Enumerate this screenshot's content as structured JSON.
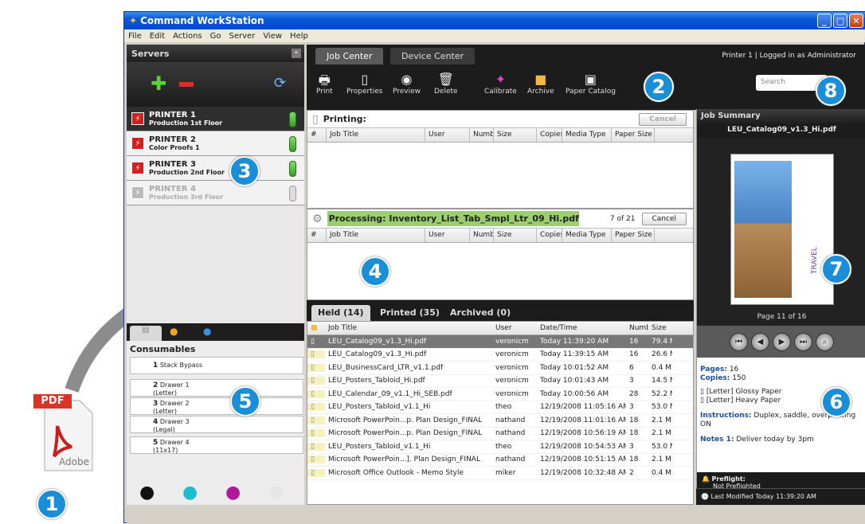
{
  "app": {
    "title": "Command WorkStation"
  },
  "menu": [
    "File",
    "Edit",
    "Actions",
    "Go",
    "Server",
    "View",
    "Help"
  ],
  "pdf": {
    "label": "PDF",
    "brand": "Adobe"
  },
  "badges": [
    "1",
    "2",
    "3",
    "4",
    "5",
    "6",
    "7",
    "8"
  ],
  "servers": {
    "header": "Servers",
    "items": [
      {
        "name": "PRINTER 1",
        "location": "Production 1st Floor"
      },
      {
        "name": "PRINTER 2",
        "location": "Color Proofs 1"
      },
      {
        "name": "PRINTER 3",
        "location": "Production 2nd Floor"
      },
      {
        "name": "PRINTER 4",
        "location": "Production 3rd Floor"
      }
    ]
  },
  "consumables": {
    "header": "Consumables",
    "trays": [
      {
        "num": "1",
        "name": "Stack Bypass",
        "size": ""
      },
      {
        "num": "2",
        "name": "Drawer 1",
        "size": "(Letter)"
      },
      {
        "num": "3",
        "name": "Drawer 2",
        "size": "(Letter)"
      },
      {
        "num": "4",
        "name": "Drawer 3",
        "size": "(Legal)"
      },
      {
        "num": "5",
        "name": "Drawer 4",
        "size": "(11x17)"
      }
    ]
  },
  "tabs": {
    "job_center": "Job Center",
    "device_center": "Device Center"
  },
  "status": "Printer 1 | Logged in as Administrator",
  "toolbar": {
    "print": "Print",
    "properties": "Properties",
    "preview": "Preview",
    "delete": "Delete",
    "calibrate": "Calibrate",
    "archive": "Archive",
    "paper_catalog": "Paper Catalog"
  },
  "search": {
    "placeholder": "Search"
  },
  "columns": {
    "num": "#",
    "job_title": "Job Title",
    "user": "User",
    "number": "Numbe",
    "size": "Size",
    "copies": "Copies",
    "media_type": "Media Type",
    "paper_size": "Paper Size"
  },
  "printing": {
    "label": "Printing:",
    "cancel": "Cancel"
  },
  "processing": {
    "label": "Processing:",
    "file": "Inventory_List_Tab_Smpl_Ltr_09_Hi.pdf",
    "count": "7 of 21",
    "cancel": "Cancel"
  },
  "held_tabs": {
    "held": "Held (14)",
    "printed": "Printed (35)",
    "archived": "Archived (0)"
  },
  "held_columns": {
    "job_title": "Job Title",
    "user": "User",
    "datetime": "Date/Time",
    "number": "Numbe",
    "size": "Size"
  },
  "held_rows": [
    {
      "title": "LEU_Catalog09_v1.3_Hi.pdf",
      "user": "veronicm",
      "date": "Today 11:39:20 AM",
      "num": "16",
      "size": "79.4 N"
    },
    {
      "title": "LEU_Catalog09_v1.3_Hi.pdf",
      "user": "veronicm",
      "date": "Today 11:39:15 AM",
      "num": "16",
      "size": "26.6 N"
    },
    {
      "title": "LEU_BusinessCard_LTR_v1.1.pdf",
      "user": "veronicm",
      "date": "Today 10:01:52 AM",
      "num": "6",
      "size": "0.4 MI"
    },
    {
      "title": "LEU_Posters_Tabloid_Hi.pdf",
      "user": "veronicm",
      "date": "Today 10:01:43 AM",
      "num": "3",
      "size": "14.5 N"
    },
    {
      "title": "LEU_Calendar_09_v1.1_Hi_SEB.pdf",
      "user": "veronicm",
      "date": "Today 10:00:56 AM",
      "num": "28",
      "size": "52.2 N"
    },
    {
      "title": "LEU_Posters_Tabloid_v1.1_Hi",
      "user": "theo",
      "date": "12/19/2008 11:05:16 AM",
      "num": "3",
      "size": "53.0 N"
    },
    {
      "title": "Microsoft PowerPoin...p. Plan Design_FINAL",
      "user": "nathand",
      "date": "12/19/2008 11:01:16 AM",
      "num": "18",
      "size": "2.1 MI"
    },
    {
      "title": "Microsoft PowerPoin...p. Plan Design_FINAL",
      "user": "nathand",
      "date": "12/19/2008 10:56:19 AM",
      "num": "18",
      "size": "2.1 MI"
    },
    {
      "title": "LEU_Posters_Tabloid_v1.1_Hi",
      "user": "theo",
      "date": "12/19/2008 10:54:53 AM",
      "num": "3",
      "size": "53.0 N"
    },
    {
      "title": "Microsoft PowerPoin...]. Plan Design_FINAL",
      "user": "nathand",
      "date": "12/19/2008 10:51:15 AM",
      "num": "18",
      "size": "2.1 MI"
    },
    {
      "title": "Microsoft Office Outlook - Memo Style",
      "user": "miker",
      "date": "12/19/2008 10:32:48 AM",
      "num": "2",
      "size": "0.4 MI"
    }
  ],
  "summary": {
    "header": "Job Summary",
    "file": "LEU_Catalog09_v1.3_Hi.pdf",
    "page": "Page 11 of 16",
    "pages_label": "Pages:",
    "pages": "16",
    "copies_label": "Copies:",
    "copies": "150",
    "papers": [
      "[Letter] Glossy Paper",
      "[Letter] Heavy Paper"
    ],
    "instructions_label": "Instructions:",
    "instructions": "Duplex, saddle, overprinting ON",
    "notes_label": "Notes 1:",
    "notes": "Deliver today by 3pm",
    "preflight_label": "Preflight:",
    "preflight": "Not Preflighted",
    "modified": "Last Modified Today 11:39:20 AM",
    "thumb_text": "TRAVEL"
  },
  "colors": {
    "accent": "#1a8fd8",
    "header_dark": "#1c1c1c",
    "processing_green": "#9bcf6e",
    "selected_row": "#777777"
  }
}
